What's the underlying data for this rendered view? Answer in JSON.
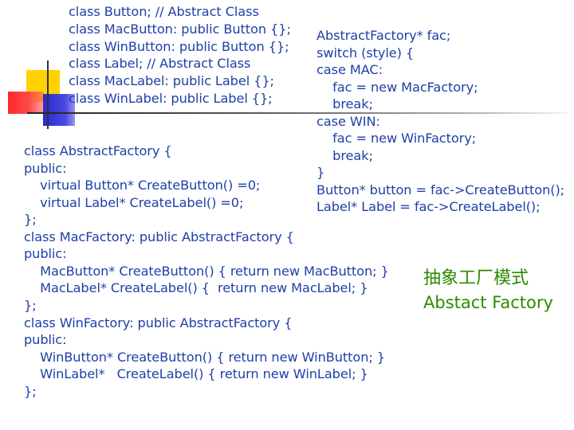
{
  "decor_colors": {
    "yellow": "#ffd200",
    "red": "#ff3030",
    "blue": "#3030d8",
    "rule": "#444444"
  },
  "class_declarations": [
    "class Button; // Abstract Class",
    "class MacButton: public Button {};",
    "class WinButton: public Button {};",
    "class Label; // Abstract Class",
    "class MacLabel: public Label {};",
    "class WinLabel: public Label {};"
  ],
  "client_code": [
    "AbstractFactory* fac;",
    "switch (style) {",
    "case MAC:",
    "    fac = new MacFactory;",
    "    break;",
    "case WIN:",
    "    fac = new WinFactory;",
    "    break;",
    "}",
    "Button* button = fac->CreateButton();",
    "Label* Label = fac->CreateLabel();"
  ],
  "factory_code": [
    "class AbstractFactory {",
    "public:",
    "    virtual Button* CreateButton() =0;",
    "    virtual Label* CreateLabel() =0;",
    "};",
    "class MacFactory: public AbstractFactory {",
    "public:",
    "    MacButton* CreateButton() { return new MacButton; }",
    "    MacLabel* CreateLabel() {  return new MacLabel; }",
    "};",
    "class WinFactory: public AbstractFactory {",
    "public:",
    "    WinButton* CreateButton() { return new WinButton; }",
    "    WinLabel*   CreateLabel() { return new WinLabel; }",
    "};"
  ],
  "title": {
    "chinese": "抽象工厂模式",
    "english": "Abstact Factory"
  },
  "text_color": "#1f3fa8",
  "title_color": "#2e8b00"
}
